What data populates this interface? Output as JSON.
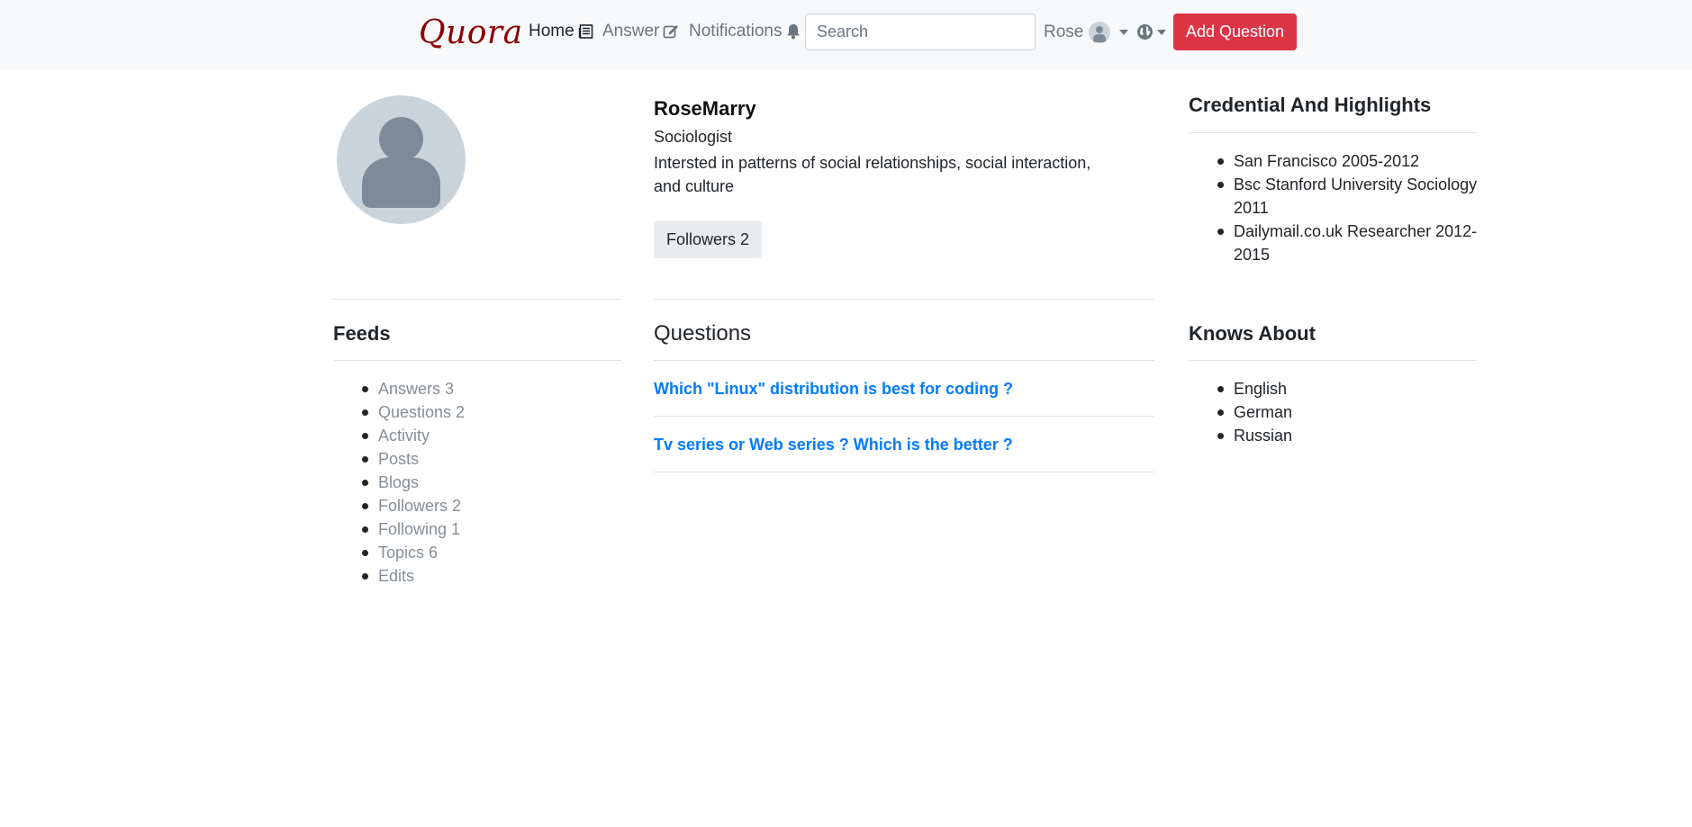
{
  "navbar": {
    "brand": "Quora",
    "home_label": "Home",
    "answer_label": "Answer",
    "notifications_label": "Notifications",
    "search_placeholder": "Search",
    "user_name": "Rose",
    "add_question_label": "Add Question"
  },
  "profile": {
    "name": "RoseMarry",
    "title": "Sociologist",
    "bio": "Intersted in patterns of social relationships, social interaction, and culture",
    "followers_label": "Followers 2"
  },
  "credentials": {
    "title": "Credential And Highlights",
    "items": [
      "San Francisco 2005-2012",
      "Bsc Stanford University Sociology 2011",
      "Dailymail.co.uk Researcher 2012-2015"
    ]
  },
  "feeds": {
    "title": "Feeds",
    "items": [
      "Answers 3",
      "Questions 2",
      "Activity",
      "Posts",
      "Blogs",
      "Followers 2",
      "Following 1",
      "Topics 6",
      "Edits"
    ]
  },
  "questions": {
    "title": "Questions",
    "items": [
      "Which \"Linux\" distribution is best for coding ?",
      "Tv series or Web series ? Which is the better ?"
    ]
  },
  "knows_about": {
    "title": "Knows About",
    "items": [
      "English",
      "German",
      "Russian"
    ]
  },
  "colors": {
    "brand": "#8b0000",
    "primary_button": "#dc3545",
    "link": "#007bff",
    "navbar_bg": "#f8f9fa"
  },
  "icons": {
    "home": "newspaper-icon",
    "answer": "edit-icon",
    "notifications": "bell-icon",
    "language": "globe-icon"
  }
}
